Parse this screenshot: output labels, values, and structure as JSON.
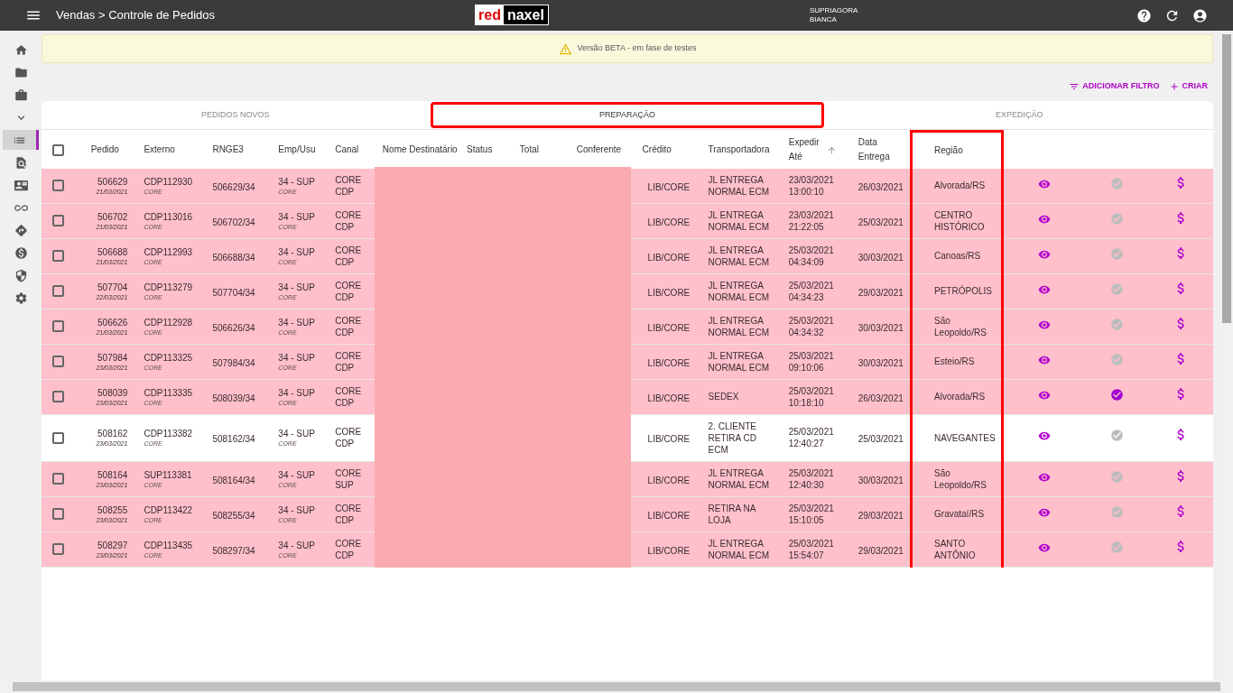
{
  "topbar": {
    "breadcrumb": "Vendas > Controle de Pedidos",
    "logo": {
      "left": "red",
      "right": "naxel"
    },
    "user": {
      "line1": "SUPRIAGORA",
      "line2": "BIANCA"
    }
  },
  "sidebar": {
    "items": [
      {
        "selected": false
      },
      {
        "selected": false
      },
      {
        "selected": false
      },
      {
        "selected": false
      },
      {
        "selected": true
      },
      {
        "selected": false
      },
      {
        "selected": false
      },
      {
        "selected": false
      },
      {
        "selected": false
      },
      {
        "selected": false
      },
      {
        "selected": false
      },
      {
        "selected": false
      }
    ]
  },
  "banner": {
    "text": "Versão BETA - em fase de testes"
  },
  "actions": [
    {
      "label": "ADICIONAR FILTRO"
    },
    {
      "label": "CRIAR"
    }
  ],
  "tabs": [
    {
      "label": "PEDIDOS NOVOS",
      "selected": false,
      "highlighted": false
    },
    {
      "label": "PREPARAÇÃO",
      "selected": true,
      "highlighted": true
    },
    {
      "label": "EXPEDIÇÃO",
      "selected": false,
      "highlighted": false
    }
  ],
  "table": {
    "select_all": {
      "checked": false
    },
    "columns": [
      {
        "label": "Pedido",
        "kind": "plain"
      },
      {
        "label": "Externo",
        "kind": "plain"
      },
      {
        "label": "RNGE3",
        "kind": "plain"
      },
      {
        "label": "Emp/Usu",
        "kind": "plain"
      },
      {
        "label": "Canal",
        "kind": "plain"
      },
      {
        "label": "Nome Destinatário",
        "kind": "redacted"
      },
      {
        "label": "Status",
        "kind": "redacted"
      },
      {
        "label": "Total",
        "kind": "redacted"
      },
      {
        "label": "Conferente",
        "kind": "redacted"
      },
      {
        "label": "Crédito",
        "kind": "plain"
      },
      {
        "label": "Transportadora",
        "kind": "plain"
      },
      {
        "label": "Expedir Até",
        "kind": "sorted"
      },
      {
        "label": "Data Entrega",
        "kind": "plain"
      },
      {
        "label": "Região",
        "kind": "highlighted"
      }
    ],
    "rows": [
      {
        "checked": false,
        "color": "#ffc0cb",
        "pedido": "506629",
        "data": "21/03/2021",
        "externo": "CDP112930",
        "externo_sub": "CORE",
        "rnge3": "506629/34",
        "emp": "34 - SUP",
        "emp_sub": "CORE",
        "canal": "CORE CDP",
        "credito": "LIB/CORE",
        "transportadora": "JL ENTREGA NORMAL ECM",
        "expedir_data": "23/03/2021",
        "expedir_hora": "13:00:10",
        "entrega": "26/03/2021",
        "regiao": "Alvorada/RS",
        "confirmed": false
      },
      {
        "checked": false,
        "color": "#ffc0cb",
        "pedido": "506702",
        "data": "21/03/2021",
        "externo": "CDP113016",
        "externo_sub": "CORE",
        "rnge3": "506702/34",
        "emp": "34 - SUP",
        "emp_sub": "CORE",
        "canal": "CORE CDP",
        "credito": "LIB/CORE",
        "transportadora": "JL ENTREGA NORMAL ECM",
        "expedir_data": "23/03/2021",
        "expedir_hora": "21:22:05",
        "entrega": "25/03/2021",
        "regiao": "CENTRO HISTÓRICO",
        "confirmed": false
      },
      {
        "checked": false,
        "color": "#ffc0cb",
        "pedido": "506688",
        "data": "21/03/2021",
        "externo": "CDP112993",
        "externo_sub": "CORE",
        "rnge3": "506688/34",
        "emp": "34 - SUP",
        "emp_sub": "CORE",
        "canal": "CORE CDP",
        "credito": "LIB/CORE",
        "transportadora": "JL ENTREGA NORMAL ECM",
        "expedir_data": "25/03/2021",
        "expedir_hora": "04:34:09",
        "entrega": "30/03/2021",
        "regiao": "Canoas/RS",
        "confirmed": false
      },
      {
        "checked": false,
        "color": "#ffc0cb",
        "pedido": "507704",
        "data": "22/03/2021",
        "externo": "CDP113279",
        "externo_sub": "CORE",
        "rnge3": "507704/34",
        "emp": "34 - SUP",
        "emp_sub": "CORE",
        "canal": "CORE CDP",
        "credito": "LIB/CORE",
        "transportadora": "JL ENTREGA NORMAL ECM",
        "expedir_data": "25/03/2021",
        "expedir_hora": "04:34:23",
        "entrega": "29/03/2021",
        "regiao": "PETRÓPOLIS",
        "confirmed": false
      },
      {
        "checked": false,
        "color": "#ffc0cb",
        "pedido": "506626",
        "data": "21/03/2021",
        "externo": "CDP112928",
        "externo_sub": "CORE",
        "rnge3": "506626/34",
        "emp": "34 - SUP",
        "emp_sub": "CORE",
        "canal": "CORE CDP",
        "credito": "LIB/CORE",
        "transportadora": "JL ENTREGA NORMAL ECM",
        "expedir_data": "25/03/2021",
        "expedir_hora": "04:34:32",
        "entrega": "30/03/2021",
        "regiao": "São Leopoldo/RS",
        "confirmed": false
      },
      {
        "checked": false,
        "color": "#ffc0cb",
        "pedido": "507984",
        "data": "23/03/2021",
        "externo": "CDP113325",
        "externo_sub": "CORE",
        "rnge3": "507984/34",
        "emp": "34 - SUP",
        "emp_sub": "CORE",
        "canal": "CORE CDP",
        "credito": "LIB/CORE",
        "transportadora": "JL ENTREGA NORMAL ECM",
        "expedir_data": "25/03/2021",
        "expedir_hora": "09:10:06",
        "entrega": "30/03/2021",
        "regiao": "Esteio/RS",
        "confirmed": false
      },
      {
        "checked": false,
        "color": "#ffc0cb",
        "pedido": "508039",
        "data": "23/03/2021",
        "externo": "CDP113335",
        "externo_sub": "CORE",
        "rnge3": "508039/34",
        "emp": "34 - SUP",
        "emp_sub": "CORE",
        "canal": "CORE CDP",
        "credito": "LIB/CORE",
        "transportadora": "SEDEX",
        "expedir_data": "25/03/2021",
        "expedir_hora": "10:18:10",
        "entrega": "26/03/2021",
        "regiao": "Alvorada/RS",
        "confirmed": true
      },
      {
        "checked": false,
        "color": "#ffffff",
        "pedido": "508162",
        "data": "23/03/2021",
        "externo": "CDP113382",
        "externo_sub": "CORE",
        "rnge3": "508162/34",
        "emp": "34 - SUP",
        "emp_sub": "CORE",
        "canal": "CORE CDP",
        "credito": "LIB/CORE",
        "transportadora": "2. CLIENTE RETIRA CD ECM",
        "expedir_data": "25/03/2021",
        "expedir_hora": "12:40:27",
        "entrega": "25/03/2021",
        "regiao": "NAVEGANTES",
        "confirmed": false
      },
      {
        "checked": false,
        "color": "#ffc0cb",
        "pedido": "508164",
        "data": "23/03/2021",
        "externo": "SUP113381",
        "externo_sub": "CORE",
        "rnge3": "508164/34",
        "emp": "34 - SUP",
        "emp_sub": "CORE",
        "canal": "CORE SUP",
        "credito": "LIB/CORE",
        "transportadora": "JL ENTREGA NORMAL ECM",
        "expedir_data": "25/03/2021",
        "expedir_hora": "12:40:30",
        "entrega": "30/03/2021",
        "regiao": "São Leopoldo/RS",
        "confirmed": false
      },
      {
        "checked": false,
        "color": "#ffc0cb",
        "pedido": "508255",
        "data": "23/03/2021",
        "externo": "CDP113422",
        "externo_sub": "CORE",
        "rnge3": "508255/34",
        "emp": "34 - SUP",
        "emp_sub": "CORE",
        "canal": "CORE CDP",
        "credito": "LIB/CORE",
        "transportadora": "RETIRA NA LOJA",
        "expedir_data": "25/03/2021",
        "expedir_hora": "15:10:05",
        "entrega": "29/03/2021",
        "regiao": "Gravataí/RS",
        "confirmed": false
      },
      {
        "checked": false,
        "color": "#ffc0cb",
        "pedido": "508297",
        "data": "23/03/2021",
        "externo": "CDP113435",
        "externo_sub": "CORE",
        "rnge3": "508297/34",
        "emp": "34 - SUP",
        "emp_sub": "CORE",
        "canal": "CORE CDP",
        "credito": "LIB/CORE",
        "transportadora": "JL ENTREGA NORMAL ECM",
        "expedir_data": "25/03/2021",
        "expedir_hora": "15:54:07",
        "entrega": "29/03/2021",
        "regiao": "SANTO ANTÔNIO",
        "confirmed": false
      }
    ]
  }
}
